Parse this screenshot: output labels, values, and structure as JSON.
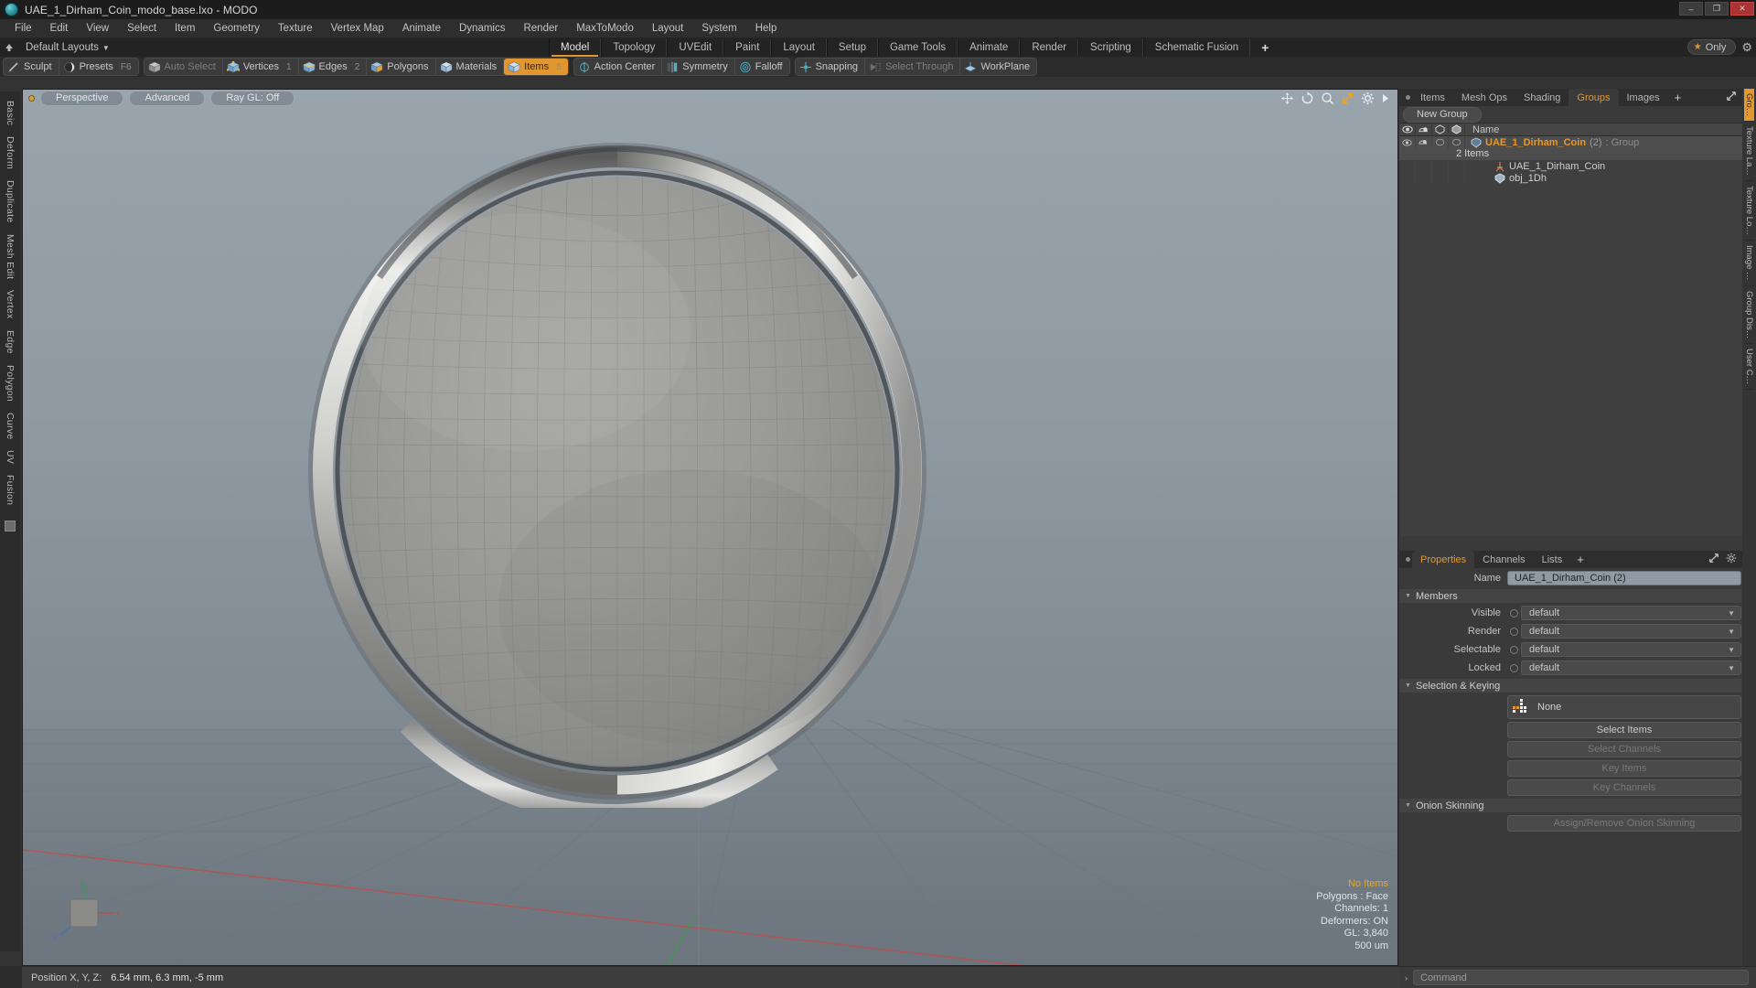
{
  "titlebar": {
    "title": "UAE_1_Dirham_Coin_modo_base.lxo - MODO",
    "minimize": "–",
    "maximize": "❐",
    "close": "✕"
  },
  "menu": [
    "File",
    "Edit",
    "View",
    "Select",
    "Item",
    "Geometry",
    "Texture",
    "Vertex Map",
    "Animate",
    "Dynamics",
    "Render",
    "MaxToModo",
    "Layout",
    "System",
    "Help"
  ],
  "layoutrow": {
    "layouts_label": "Default Layouts",
    "caret": "▼",
    "tabs": [
      "Model",
      "Topology",
      "UVEdit",
      "Paint",
      "Layout",
      "Setup",
      "Game Tools",
      "Animate",
      "Render",
      "Scripting",
      "Schematic Fusion"
    ],
    "active_tab": "Model",
    "plus": "+",
    "only_label": "Only",
    "star": "★"
  },
  "toolbar": {
    "groups": [
      {
        "items": [
          {
            "label": "Sculpt",
            "icon": "pencil-icon",
            "state": "normal",
            "key": ""
          },
          {
            "label": "Presets",
            "icon": "sphere-icon",
            "state": "normal",
            "key": "F6"
          }
        ]
      },
      {
        "items": [
          {
            "label": "Auto Select",
            "icon": "cube-grey-icon",
            "state": "dim",
            "key": ""
          },
          {
            "label": "Vertices",
            "icon": "cube-vertex-icon",
            "state": "normal",
            "key": "1"
          },
          {
            "label": "Edges",
            "icon": "cube-edge-icon",
            "state": "normal",
            "key": "2"
          },
          {
            "label": "Polygons",
            "icon": "cube-poly-icon",
            "state": "normal",
            "key": ""
          },
          {
            "label": "Materials",
            "icon": "cube-mat-icon",
            "state": "normal",
            "key": ""
          },
          {
            "label": "Items",
            "icon": "cube-item-icon",
            "state": "selected",
            "key": "5"
          }
        ]
      },
      {
        "items": [
          {
            "label": "Action Center",
            "icon": "action-center-icon",
            "state": "normal",
            "key": ""
          },
          {
            "label": "Symmetry",
            "icon": "symmetry-icon",
            "state": "normal",
            "key": ""
          },
          {
            "label": "Falloff",
            "icon": "falloff-icon",
            "state": "normal",
            "key": ""
          }
        ]
      },
      {
        "items": [
          {
            "label": "Snapping",
            "icon": "snapping-icon",
            "state": "normal",
            "key": ""
          },
          {
            "label": "Select Through",
            "icon": "select-through-icon",
            "state": "dim",
            "key": ""
          },
          {
            "label": "WorkPlane",
            "icon": "workplane-icon",
            "state": "normal",
            "key": ""
          }
        ]
      }
    ]
  },
  "left_tool_tabs": [
    "Basic",
    "Deform",
    "Duplicate",
    "Mesh Edit",
    "Vertex",
    "Edge",
    "Polygon",
    "Curve",
    "UV",
    "Fusion"
  ],
  "viewport": {
    "pills": [
      "Perspective",
      "Advanced",
      "Ray GL: Off"
    ],
    "nav_icons": [
      "move-icon",
      "rotate-icon",
      "zoom-icon",
      "fit-icon",
      "gear-icon",
      "arrow-icon"
    ],
    "stats": {
      "selection": "No Items",
      "polygons": "Polygons : Face",
      "channels": "Channels: 1",
      "deformers": "Deformers: ON",
      "gl": "GL: 3,840",
      "scale": "500 um"
    },
    "axis": {
      "x": "x",
      "y": "y",
      "z": "z"
    }
  },
  "right_panel": {
    "tabs": [
      "Items",
      "Mesh Ops",
      "Shading",
      "Groups",
      "Images"
    ],
    "active_tab": "Groups",
    "plus": "+",
    "new_group_button": "New Group",
    "tree_header": {
      "col_eye": "eye-icon",
      "col_render": "render-icon",
      "col_shaded": "shaded-icon",
      "col_wire": "wire-icon",
      "name": "Name"
    },
    "tree": [
      {
        "label": "UAE_1_Dirham_Coin",
        "count": "(2)",
        "type": ": Group",
        "icon": "group-icon",
        "selected": true,
        "sub": "2 Items",
        "indent": 0
      },
      {
        "label": "UAE_1_Dirham_Coin",
        "count": "",
        "type": "",
        "icon": "locator-icon",
        "selected": false,
        "sub": "",
        "indent": 1
      },
      {
        "label": "obj_1Dh",
        "count": "",
        "type": "",
        "icon": "mesh-icon",
        "selected": false,
        "sub": "",
        "indent": 1
      }
    ]
  },
  "properties": {
    "tabs": [
      "Properties",
      "Channels",
      "Lists"
    ],
    "active_tab": "Properties",
    "plus": "+",
    "name_label": "Name",
    "name_value": "UAE_1_Dirham_Coin (2)",
    "sections": {
      "members": "Members",
      "selection_keying": "Selection & Keying",
      "onion_skinning": "Onion Skinning"
    },
    "member_rows": [
      {
        "label": "Visible",
        "value": "default"
      },
      {
        "label": "Render",
        "value": "default"
      },
      {
        "label": "Selectable",
        "value": "default"
      },
      {
        "label": "Locked",
        "value": "default"
      }
    ],
    "selection_none": "None",
    "buttons": [
      {
        "label": "Select Items",
        "disabled": false
      },
      {
        "label": "Select Channels",
        "disabled": true
      },
      {
        "label": "Key Items",
        "disabled": true
      },
      {
        "label": "Key Channels",
        "disabled": true
      }
    ],
    "onion_button": {
      "label": "Assign/Remove Onion Skinning",
      "disabled": true
    },
    "side_tabs": [
      {
        "label": "Gro…",
        "active": true
      },
      {
        "label": "Texture La…",
        "active": false
      },
      {
        "label": "Texture Lo…",
        "active": false
      },
      {
        "label": "Image …",
        "active": false
      },
      {
        "label": "Group Dis…",
        "active": false
      },
      {
        "label": "User C…",
        "active": false
      }
    ]
  },
  "statusbar": {
    "position_label": "Position X, Y, Z:",
    "position_value": "6.54 mm, 6.3 mm, -5 mm"
  },
  "commandbar": {
    "caret": "›",
    "placeholder": "Command"
  },
  "colors": {
    "accent": "#e5982e",
    "panel": "#3a3a3a",
    "dark": "#2b2b2b",
    "text": "#c8c8c8"
  }
}
